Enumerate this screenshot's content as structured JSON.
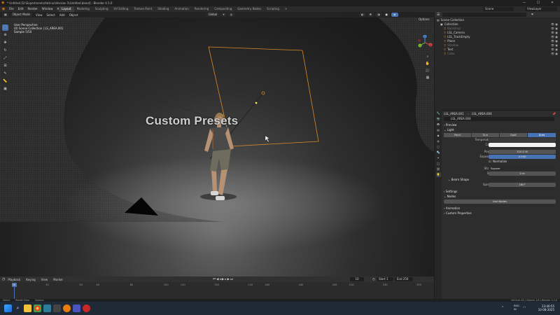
{
  "window": {
    "title": "* Untitled [D:\\Experiments\\Add-on\\Version 5\\Untitled.blend] - Blender 4.5.0",
    "controls": [
      "—",
      "☐",
      "✕"
    ]
  },
  "menu": {
    "items": [
      "File",
      "Edit",
      "Render",
      "Window",
      "Help"
    ],
    "workspaces": [
      "Layout",
      "Modeling",
      "Sculpting",
      "UV Editing",
      "Texture Paint",
      "Shading",
      "Animation",
      "Rendering",
      "Compositing",
      "Geometry Nodes",
      "Scripting"
    ],
    "active_workspace": "Layout",
    "scene_label": "Scene",
    "view_layer_label": "ViewLayer"
  },
  "viewport": {
    "header": {
      "mode": "Object Mode",
      "menus": [
        "View",
        "Select",
        "Add",
        "Object"
      ],
      "orientation": "Global",
      "options": "Options"
    },
    "info_lines": [
      "User Perspective",
      "(0) Scene Collection | LS_AREA.001",
      "Sample 5/50"
    ],
    "overlay_text": "Custom Presets",
    "gizmo_axes": [
      "X",
      "Y",
      "Z"
    ]
  },
  "outliner": {
    "search_placeholder": "",
    "rows": [
      {
        "label": "Scene Collection",
        "indent": 0,
        "dim": false
      },
      {
        "label": "Collection",
        "indent": 1,
        "dim": false
      },
      {
        "label": "Backdrop",
        "indent": 2,
        "dim": true
      },
      {
        "label": "LSL_Camera",
        "indent": 2,
        "dim": false
      },
      {
        "label": "LSL_TrackEmpty",
        "indent": 2,
        "dim": false
      },
      {
        "label": "Plane",
        "indent": 2,
        "dim": false
      },
      {
        "label": "Shadow",
        "indent": 2,
        "dim": true
      },
      {
        "label": "Text",
        "indent": 2,
        "dim": false
      },
      {
        "label": "Cube",
        "indent": 2,
        "dim": true
      }
    ]
  },
  "properties": {
    "breadcrumb": [
      "LSL_AREA.001",
      "LSL_AREA.004"
    ],
    "datablock": "LSL_AREA.004",
    "sections": {
      "preview": "Preview",
      "light": "Light",
      "beam_shape": "Beam Shape",
      "settings": "Settings",
      "nodes": "Nodes",
      "animation": "Animation",
      "custom_properties": "Custom Properties"
    },
    "light_types": [
      "Point",
      "Sun",
      "Spot",
      "Area"
    ],
    "active_light_type": "Area",
    "fields": {
      "temperature_label": "Temperature",
      "color_label": "Color",
      "color_value": "#f2f2f2",
      "power_label": "Power",
      "power_value": "320.0 W",
      "exposure_label": "Exposure",
      "exposure_value": "0.000",
      "normalize_label": "Normalize",
      "shape_label": "Shape",
      "shape_value": "Square",
      "size_label": "Size",
      "size_value": "2 m",
      "spread_label": "Spread",
      "spread_value": "180°",
      "use_nodes_label": "Use Nodes"
    }
  },
  "timeline": {
    "menus": [
      "Playback",
      "Keying",
      "View",
      "Marker"
    ],
    "current_frame": "10",
    "start_label": "Start",
    "start_value": "1",
    "end_label": "End",
    "end_value": "250",
    "ticks": [
      "10",
      "30",
      "50",
      "60",
      "80",
      "100",
      "110",
      "130",
      "150",
      "160",
      "180",
      "200",
      "210",
      "230",
      "250"
    ],
    "tick_values": [
      10,
      30,
      50,
      60,
      80,
      100,
      110,
      130,
      150,
      160,
      180,
      200,
      210,
      230,
      250
    ]
  },
  "statusbar": {
    "left": [
      "Select",
      "Rotate View",
      "Options"
    ],
    "right": "Vertices 48 | Objects 1/8 | Blender 4.5.0"
  },
  "taskbar": {
    "language": "ENG\nIN",
    "time": "23:40:55",
    "date": "10-08-2025"
  }
}
